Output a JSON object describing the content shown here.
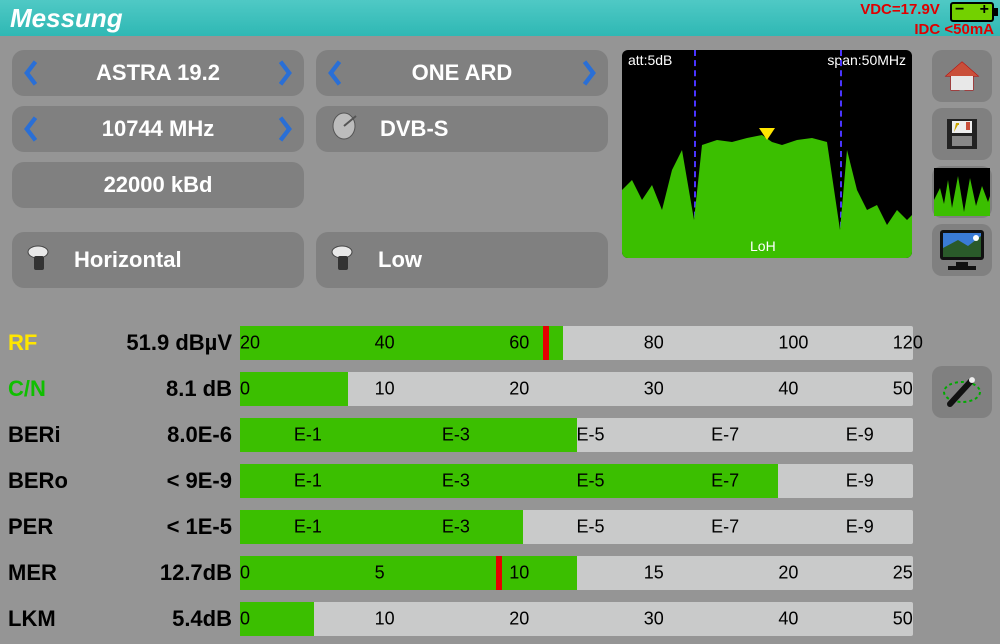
{
  "title": "Messung",
  "power": {
    "vdc": "VDC=17.9V",
    "idc": "IDC <50mA"
  },
  "selectors": {
    "satellite": "ASTRA 19.2",
    "channel": "ONE ARD",
    "frequency": "10744 MHz",
    "modulation": "DVB-S",
    "symbolrate": "22000 kBd",
    "polarization": "Horizontal",
    "band": "Low"
  },
  "spectrum": {
    "att": "att:5dB",
    "span": "span:50MHz",
    "bandlabel": "LoH"
  },
  "sidebar": {
    "home": "home-icon",
    "save": "save-icon",
    "spectrum": "spectrum-icon",
    "video": "video-icon",
    "wand": "wand-icon"
  },
  "bars": [
    {
      "key": "RF",
      "nameClass": "name-rf",
      "value": "51.9 dBµV",
      "fillPct": 48,
      "red": 45,
      "ticks": [
        {
          "p": 0,
          "l": "20"
        },
        {
          "p": 20,
          "l": "40"
        },
        {
          "p": 40,
          "l": "60"
        },
        {
          "p": 60,
          "l": "80"
        },
        {
          "p": 80,
          "l": "100"
        },
        {
          "p": 97,
          "l": "120"
        }
      ]
    },
    {
      "key": "C/N",
      "nameClass": "name-cn",
      "value": "8.1 dB",
      "fillPct": 16,
      "ticks": [
        {
          "p": 0,
          "l": "0"
        },
        {
          "p": 20,
          "l": "10"
        },
        {
          "p": 40,
          "l": "20"
        },
        {
          "p": 60,
          "l": "30"
        },
        {
          "p": 80,
          "l": "40"
        },
        {
          "p": 97,
          "l": "50"
        }
      ]
    },
    {
      "key": "BERi",
      "nameClass": "name-def",
      "value": "8.0E-6",
      "fillPct": 50,
      "ticks": [
        {
          "p": 8,
          "l": "E-1"
        },
        {
          "p": 30,
          "l": "E-3"
        },
        {
          "p": 50,
          "l": "E-5"
        },
        {
          "p": 70,
          "l": "E-7"
        },
        {
          "p": 90,
          "l": "E-9"
        }
      ]
    },
    {
      "key": "BERo",
      "nameClass": "name-def",
      "value": "< 9E-9",
      "fillPct": 80,
      "ticks": [
        {
          "p": 8,
          "l": "E-1"
        },
        {
          "p": 30,
          "l": "E-3"
        },
        {
          "p": 50,
          "l": "E-5"
        },
        {
          "p": 70,
          "l": "E-7"
        },
        {
          "p": 90,
          "l": "E-9"
        }
      ]
    },
    {
      "key": "PER",
      "nameClass": "name-def",
      "value": "< 1E-5",
      "fillPct": 42,
      "ticks": [
        {
          "p": 8,
          "l": "E-1"
        },
        {
          "p": 30,
          "l": "E-3"
        },
        {
          "p": 50,
          "l": "E-5"
        },
        {
          "p": 70,
          "l": "E-7"
        },
        {
          "p": 90,
          "l": "E-9"
        }
      ]
    },
    {
      "key": "MER",
      "nameClass": "name-def",
      "value": "12.7dB",
      "fillPct": 50,
      "red": 38,
      "ticks": [
        {
          "p": 0,
          "l": "0"
        },
        {
          "p": 20,
          "l": "5"
        },
        {
          "p": 40,
          "l": "10"
        },
        {
          "p": 60,
          "l": "15"
        },
        {
          "p": 80,
          "l": "20"
        },
        {
          "p": 97,
          "l": "25"
        }
      ]
    },
    {
      "key": "LKM",
      "nameClass": "name-def",
      "value": "5.4dB",
      "fillPct": 11,
      "ticks": [
        {
          "p": 0,
          "l": "0"
        },
        {
          "p": 20,
          "l": "10"
        },
        {
          "p": 40,
          "l": "20"
        },
        {
          "p": 60,
          "l": "30"
        },
        {
          "p": 80,
          "l": "40"
        },
        {
          "p": 97,
          "l": "50"
        }
      ]
    }
  ],
  "chart_data": {
    "type": "bar",
    "title": "Signal measurements",
    "series": [
      {
        "name": "RF",
        "value": 51.9,
        "unit": "dBµV",
        "range": [
          20,
          120
        ]
      },
      {
        "name": "C/N",
        "value": 8.1,
        "unit": "dB",
        "range": [
          0,
          50
        ]
      },
      {
        "name": "BERi",
        "value": "8.0E-6",
        "range": [
          "E-1",
          "E-9"
        ]
      },
      {
        "name": "BERo",
        "value": "<9E-9",
        "range": [
          "E-1",
          "E-9"
        ]
      },
      {
        "name": "PER",
        "value": "<1E-5",
        "range": [
          "E-1",
          "E-9"
        ]
      },
      {
        "name": "MER",
        "value": 12.7,
        "unit": "dB",
        "range": [
          0,
          25
        ]
      },
      {
        "name": "LKM",
        "value": 5.4,
        "unit": "dB",
        "range": [
          0,
          50
        ]
      }
    ],
    "spectrum": {
      "att_dB": 5,
      "span_MHz": 50,
      "band": "LoH"
    }
  }
}
